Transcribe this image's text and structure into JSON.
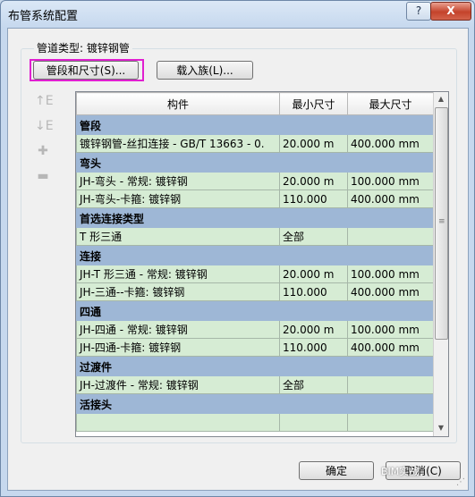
{
  "window": {
    "title": "布管系统配置",
    "help_label": "?",
    "close_label": "X"
  },
  "pipe_type": {
    "label": "管道类型: 镀锌钢管"
  },
  "buttons": {
    "segments": "管段和尺寸(S)...",
    "load_family": "载入族(L)...",
    "ok": "确定",
    "cancel": "取消(C)"
  },
  "side_tools": {
    "move_up": "↑E",
    "move_down": "↓E",
    "add": "✚",
    "remove": "▬"
  },
  "table": {
    "headers": [
      "构件",
      "最小尺寸",
      "最大尺寸"
    ],
    "groups": [
      {
        "name": "管段",
        "rows": [
          [
            "镀锌钢管-丝扣连接 - GB/T 13663 - 0.",
            "20.000 m",
            "400.000 mm"
          ]
        ]
      },
      {
        "name": "弯头",
        "rows": [
          [
            "JH-弯头 - 常规: 镀锌钢",
            "20.000 m",
            "100.000 mm"
          ],
          [
            "JH-弯头-卡箍: 镀锌钢",
            "110.000",
            "400.000 mm"
          ]
        ]
      },
      {
        "name": "首选连接类型",
        "rows": [
          [
            "T 形三通",
            "全部",
            ""
          ]
        ]
      },
      {
        "name": "连接",
        "rows": [
          [
            "JH-T 形三通 - 常规: 镀锌钢",
            "20.000 m",
            "100.000 mm"
          ],
          [
            "JH-三通--卡箍: 镀锌钢",
            "110.000",
            "400.000 mm"
          ]
        ]
      },
      {
        "name": "四通",
        "rows": [
          [
            "JH-四通 - 常规: 镀锌钢",
            "20.000 m",
            "100.000 mm"
          ],
          [
            "JH-四通-卡箍: 镀锌钢",
            "110.000",
            "400.000 mm"
          ]
        ]
      },
      {
        "name": "过渡件",
        "rows": [
          [
            "JH-过渡件 - 常规: 镀锌钢",
            "全部",
            ""
          ]
        ]
      },
      {
        "name": "活接头",
        "rows": []
      }
    ]
  },
  "watermark": "BIM实战"
}
